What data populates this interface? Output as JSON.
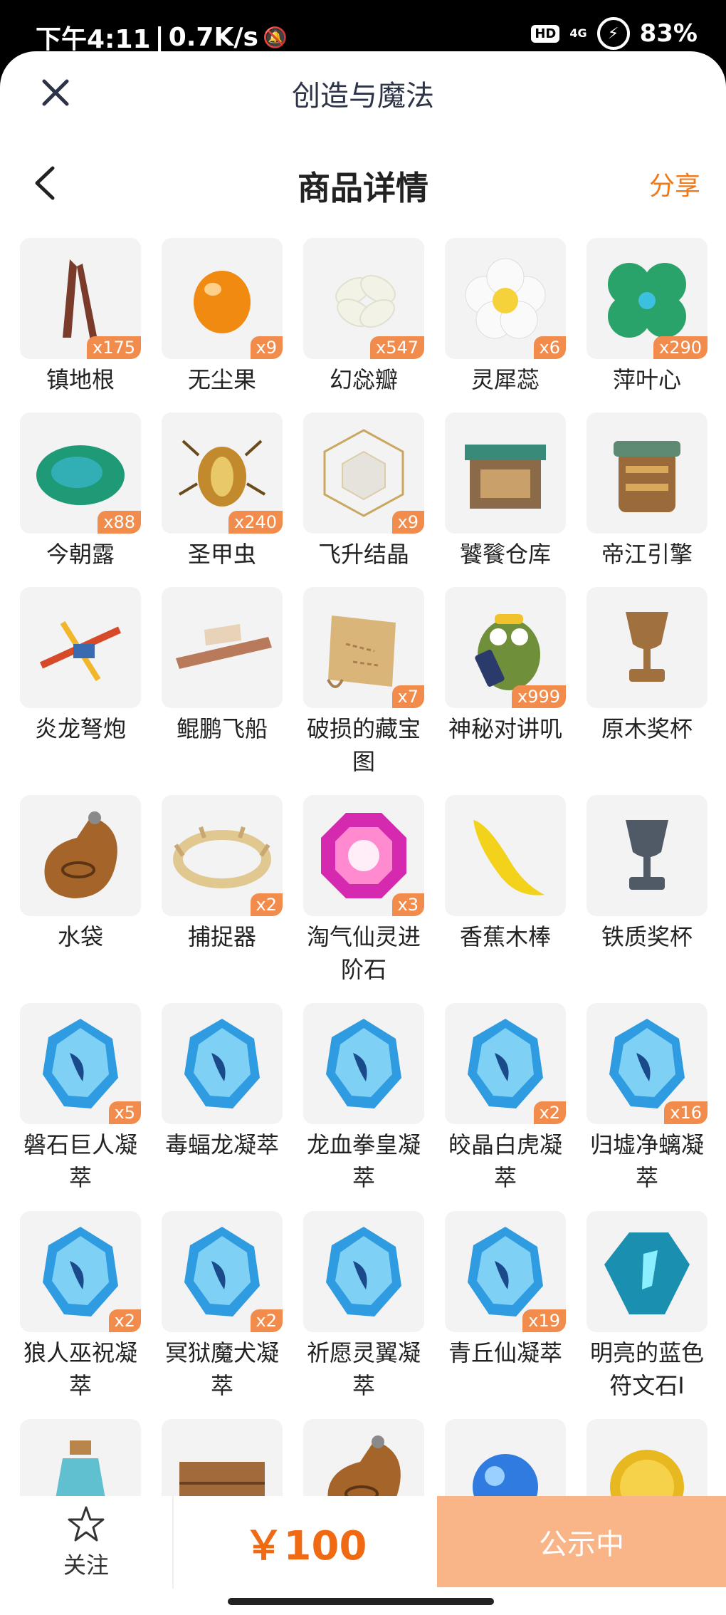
{
  "status_bar": {
    "time": "下午4:11",
    "speed": "0.7K/s",
    "hd": "HD",
    "network": "4G",
    "battery": "83%"
  },
  "mini_program": {
    "title": "创造与魔法"
  },
  "nav": {
    "title": "商品详情",
    "share": "分享"
  },
  "items": [
    {
      "name": "镇地根",
      "qty": "x175",
      "icon": "root",
      "color": "#7a3b2a"
    },
    {
      "name": "无尘果",
      "qty": "x9",
      "icon": "fruit",
      "color": "#f08a10"
    },
    {
      "name": "幻惢瓣",
      "qty": "x547",
      "icon": "petal",
      "color": "#f2f2e6"
    },
    {
      "name": "灵犀蕊",
      "qty": "x6",
      "icon": "flower",
      "color": "#f5d23a"
    },
    {
      "name": "萍叶心",
      "qty": "x290",
      "icon": "clover",
      "color": "#2aa36b"
    },
    {
      "name": "今朝露",
      "qty": "x88",
      "icon": "leaf",
      "color": "#1f9a76"
    },
    {
      "name": "圣甲虫",
      "qty": "x240",
      "icon": "beetle",
      "color": "#c28a2c"
    },
    {
      "name": "飞升结晶",
      "qty": "x9",
      "icon": "crystal-cage",
      "color": "#d9d4c3"
    },
    {
      "name": "饕餮仓库",
      "qty": "",
      "icon": "storehouse",
      "color": "#8a6a48"
    },
    {
      "name": "帝江引擎",
      "qty": "",
      "icon": "engine",
      "color": "#9a6a3a"
    },
    {
      "name": "炎龙弩炮",
      "qty": "",
      "icon": "crossbow",
      "color": "#d64a2a"
    },
    {
      "name": "鲲鹏飞船",
      "qty": "",
      "icon": "airship",
      "color": "#b87a5a"
    },
    {
      "name": "破损的藏宝图",
      "qty": "x7",
      "icon": "map-scroll",
      "color": "#d9b57a"
    },
    {
      "name": "神秘对讲叽",
      "qty": "x999",
      "icon": "walkie-bird",
      "color": "#6f8f3a"
    },
    {
      "name": "原木奖杯",
      "qty": "",
      "icon": "trophy",
      "color": "#a0703e"
    },
    {
      "name": "水袋",
      "qty": "",
      "icon": "water-bag",
      "color": "#a4642a"
    },
    {
      "name": "捕捉器",
      "qty": "x2",
      "icon": "trap",
      "color": "#e0c890"
    },
    {
      "name": "淘气仙灵进阶石",
      "qty": "x3",
      "icon": "gem",
      "color": "#d52ab0"
    },
    {
      "name": "香蕉木棒",
      "qty": "",
      "icon": "banana",
      "color": "#f2d21a"
    },
    {
      "name": "铁质奖杯",
      "qty": "",
      "icon": "trophy",
      "color": "#505a66"
    },
    {
      "name": "磐石巨人凝萃",
      "qty": "x5",
      "icon": "rune-crystal",
      "color": "#2f9be0"
    },
    {
      "name": "毒蝠龙凝萃",
      "qty": "",
      "icon": "rune-crystal",
      "color": "#2f9be0"
    },
    {
      "name": "龙血拳皇凝萃",
      "qty": "",
      "icon": "rune-crystal",
      "color": "#2f9be0"
    },
    {
      "name": "皎晶白虎凝萃",
      "qty": "x2",
      "icon": "rune-crystal",
      "color": "#2f9be0"
    },
    {
      "name": "归墟净螭凝萃",
      "qty": "x16",
      "icon": "rune-crystal",
      "color": "#2f9be0"
    },
    {
      "name": "狼人巫祝凝萃",
      "qty": "x2",
      "icon": "rune-crystal",
      "color": "#2f9be0"
    },
    {
      "name": "冥狱魔犬凝萃",
      "qty": "x2",
      "icon": "rune-crystal",
      "color": "#2f9be0"
    },
    {
      "name": "祈愿灵翼凝萃",
      "qty": "",
      "icon": "rune-crystal",
      "color": "#2f9be0"
    },
    {
      "name": "青丘仙凝萃",
      "qty": "x19",
      "icon": "rune-crystal",
      "color": "#2f9be0"
    },
    {
      "name": "明亮的蓝色符文石I",
      "qty": "",
      "icon": "rune-stone",
      "color": "#1b8fb0"
    },
    {
      "name": "",
      "qty": "",
      "icon": "bottle",
      "color": "#45b6c8"
    },
    {
      "name": "",
      "qty": "",
      "icon": "crate",
      "color": "#a06a3a"
    },
    {
      "name": "",
      "qty": "",
      "icon": "water-bag",
      "color": "#a4642a"
    },
    {
      "name": "",
      "qty": "",
      "icon": "orb",
      "color": "#2f7be0"
    },
    {
      "name": "",
      "qty": "",
      "icon": "coin",
      "color": "#e8b820"
    }
  ],
  "bottom": {
    "follow_icon": "star-icon",
    "follow_label": "关注",
    "price": "￥100",
    "status": "公示中"
  }
}
